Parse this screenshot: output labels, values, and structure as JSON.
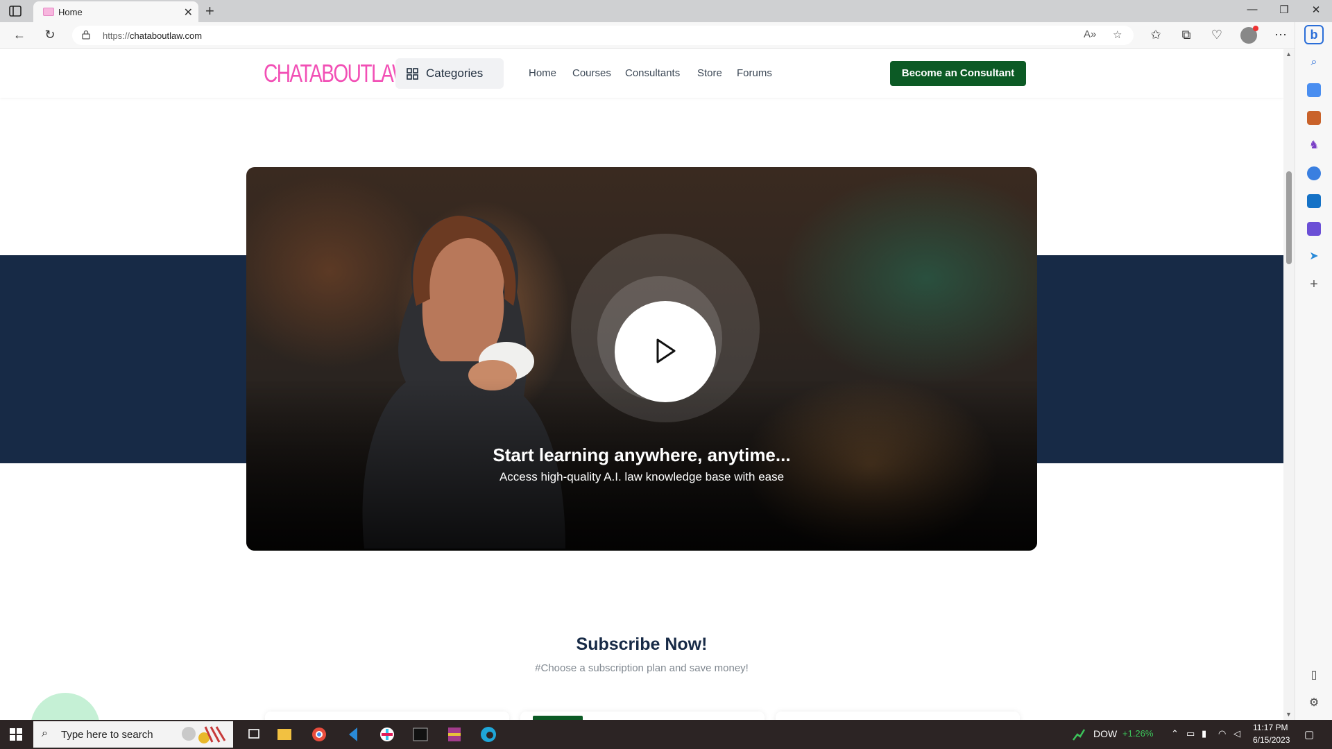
{
  "browser": {
    "tab_title": "Home",
    "tab_close": "✕",
    "new_tab": "+",
    "url_protocol": "https://",
    "url_host": "chataboutlaw.com"
  },
  "window_controls": {
    "minimize": "—",
    "restore": "❐",
    "close": "✕"
  },
  "site": {
    "logo": "CHATABOUTLAW",
    "categories_label": "Categories",
    "nav": [
      "Home",
      "Courses",
      "Consultants",
      "Store",
      "Forums"
    ],
    "cta_label": "Become an Consultant"
  },
  "hero": {
    "title": "Start learning anywhere, anytime...",
    "subtitle": "Access high-quality A.I. law knowledge base with ease"
  },
  "subscribe": {
    "title": "Subscribe Now!",
    "subtitle": "#Choose a subscription plan and save money!"
  },
  "taskbar": {
    "search_placeholder": "Type here to search",
    "ticker_name": "DOW",
    "ticker_change": "+1.26%",
    "time": "11:17 PM",
    "date": "6/15/2023"
  },
  "colors": {
    "brand_pink": "#f24fb5",
    "navy": "#172a46",
    "cta_green": "#0c5a25",
    "ticker_green": "#3cc35a"
  }
}
